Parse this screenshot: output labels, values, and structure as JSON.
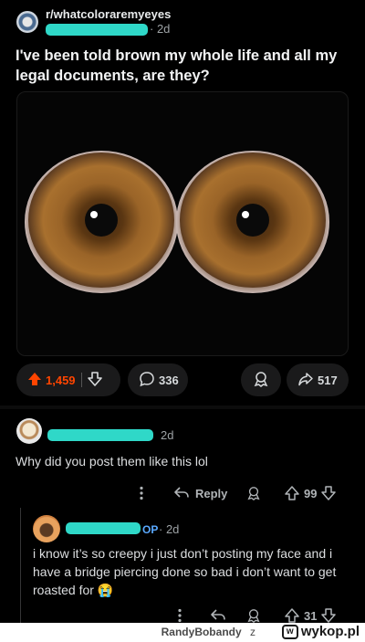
{
  "post": {
    "subreddit": "r/whatcoloraremyeyes",
    "age": "2d",
    "title": "I've been told brown my whole life and all my legal documents, are they?",
    "upvotes": "1,459",
    "comments": "336",
    "shares": "517"
  },
  "comments": [
    {
      "age": "2d",
      "text": "Why did you post them like this lol",
      "reply_label": "Reply",
      "score": "99"
    },
    {
      "op_tag": "OP",
      "age": "2d",
      "text": "i know it’s so creepy i just don’t posting my face and i have a bridge piercing done so bad i don’t want to get roasted for 😭",
      "score": "31"
    }
  ],
  "footer": {
    "username": "RandyBobandy",
    "separator": "z",
    "site": "wykop.pl",
    "logo_mark": "w"
  },
  "colors": {
    "upvote": "#ff4500",
    "redaction": "#2fd8c8",
    "op_tag": "#5aa9ff",
    "iris": "#8a5a2a"
  },
  "icons": [
    "subreddit-avatar-icon",
    "upvote-arrow-icon",
    "downvote-arrow-icon",
    "comment-bubble-icon",
    "award-icon",
    "share-icon",
    "more-dots-icon",
    "reply-arrow-icon"
  ]
}
